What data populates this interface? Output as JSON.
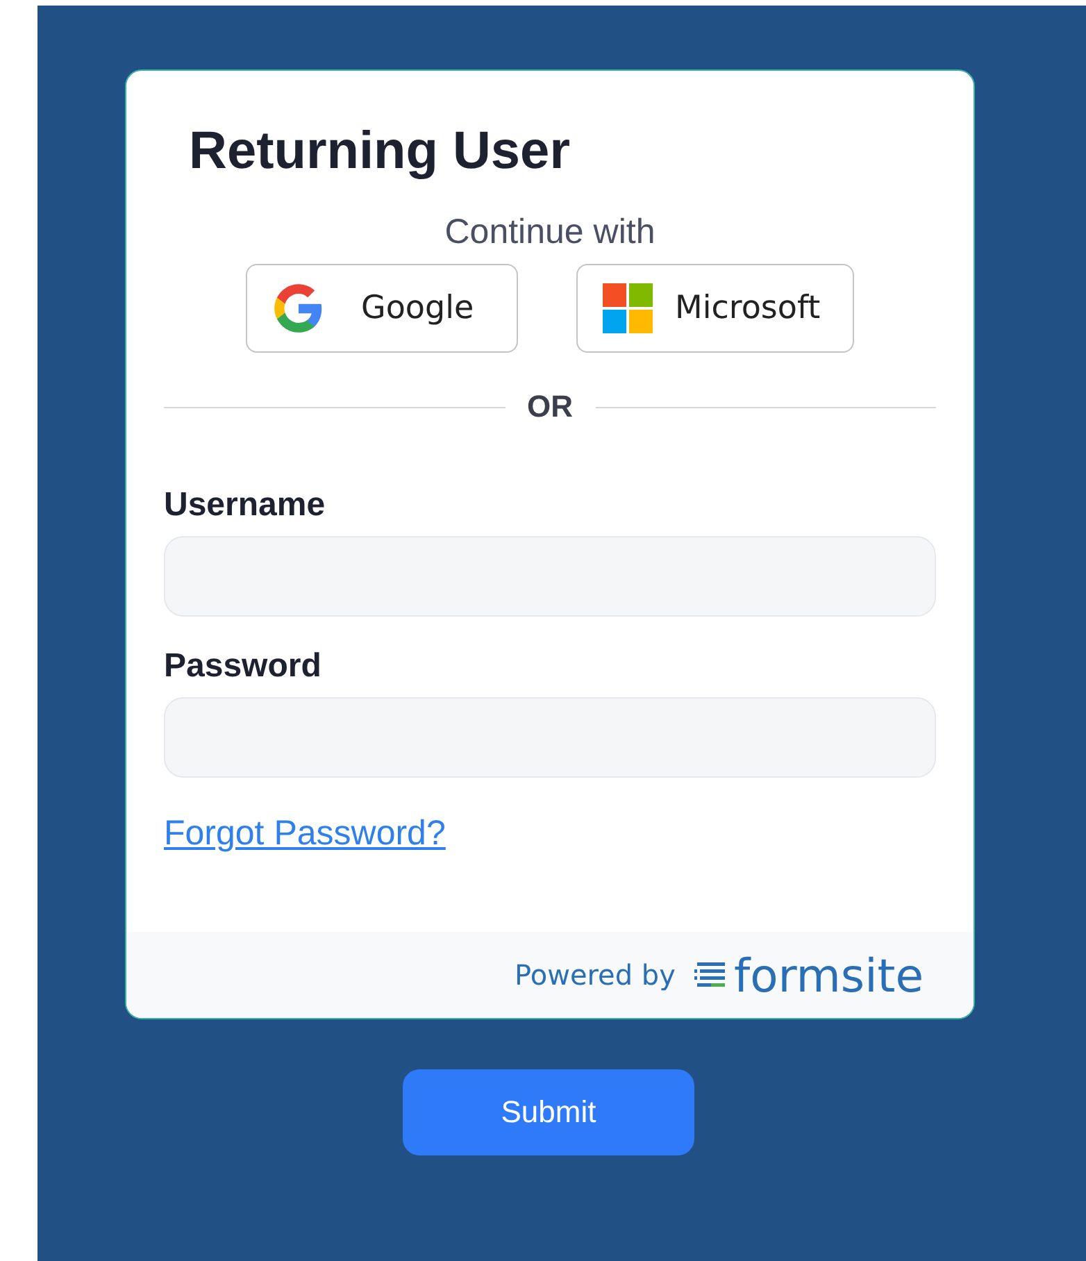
{
  "title": "Returning User",
  "continue_label": "Continue with",
  "providers": [
    {
      "kind": "google",
      "label": "Google"
    },
    {
      "kind": "microsoft",
      "label": "Microsoft"
    }
  ],
  "divider_label": "OR",
  "fields": [
    {
      "label": "Username"
    },
    {
      "label": "Password"
    }
  ],
  "forgot_link": "Forgot Password?",
  "footer": {
    "powered_by": "Powered by",
    "brand": "formsite"
  },
  "submit": "Submit"
}
